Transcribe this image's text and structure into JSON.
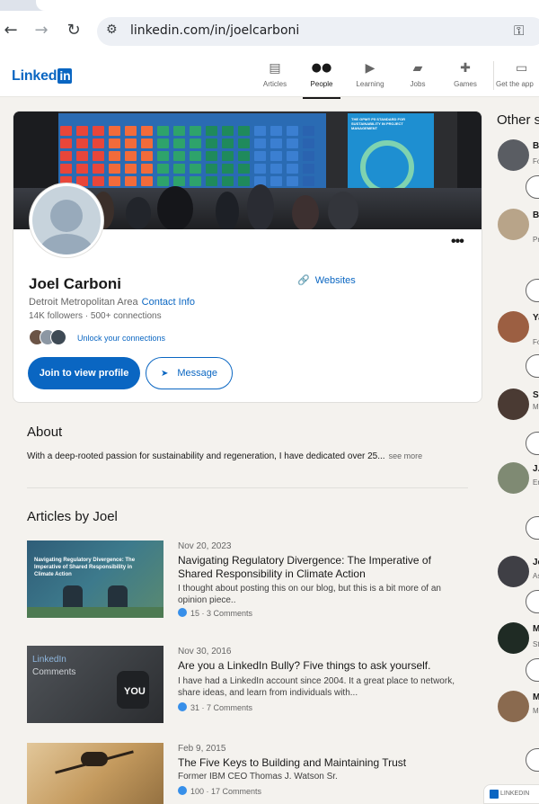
{
  "browser": {
    "url": "linkedin.com/in/joelcarboni",
    "back_icon": "←",
    "forward_icon": "→",
    "reload_icon": "↻",
    "tune_icon": "⚙",
    "key_icon": "⚿"
  },
  "header": {
    "logo_text": "Linked",
    "logo_badge": "in",
    "nav": [
      {
        "label": "Articles",
        "icon": "newspaper-icon",
        "glyph": "▤"
      },
      {
        "label": "People",
        "icon": "people-icon",
        "glyph": "👥",
        "active": true
      },
      {
        "label": "Learning",
        "icon": "play-icon",
        "glyph": "▶"
      },
      {
        "label": "Jobs",
        "icon": "briefcase-icon",
        "glyph": "💼"
      },
      {
        "label": "Games",
        "icon": "puzzle-icon",
        "glyph": "✚"
      },
      {
        "label": "Get the app",
        "icon": "laptop-icon",
        "glyph": "💻"
      }
    ]
  },
  "profile": {
    "name": "Joel Carboni",
    "location": "Detroit Metropolitan Area",
    "contact_info": "Contact Info",
    "followers": "14K followers",
    "connections": "500+ connections",
    "websites": "Websites",
    "unlock": "Unlock your connections",
    "join_button": "Join to view profile",
    "message_button": "Message",
    "more_icon": "•••"
  },
  "banner_labels": {
    "screen_text": "THE GPM® P5 STANDARD FOR SUSTAINABILITY IN PROJECT MANAGEMENT"
  },
  "about": {
    "title": "About",
    "text": "With a deep-rooted passion for sustainability and regeneration, I have dedicated over 25...",
    "see_more": "see more"
  },
  "articles": {
    "title": "Articles by Joel",
    "items": [
      {
        "date": "Nov 20, 2023",
        "title": "Navigating Regulatory Divergence: The Imperative of Shared Responsibility in Climate Action",
        "snippet": "I thought about posting this on our blog, but this is a bit more of an opinion piece..",
        "stats": "15 · 3 Comments",
        "thumb_text": "Navigating Regulatory Divergence: The Imperative of Shared Responsibility in Climate Action"
      },
      {
        "date": "Nov 30, 2016",
        "title": "Are you a LinkedIn Bully? Five things to ask yourself.",
        "snippet": "I have had a LinkedIn account since 2004. It a great place to network, share ideas, and learn from individuals with...",
        "stats": "31 · 7 Comments",
        "thumb_text_1": "LinkedIn",
        "thumb_text_2": "Comments",
        "thumb_text_3": "YOU"
      },
      {
        "date": "Feb 9, 2015",
        "title": "The Five Keys to Building and Maintaining Trust",
        "snippet": "Former IBM CEO Thomas J. Watson Sr.",
        "stats": "100 · 17 Comments"
      }
    ]
  },
  "rail": {
    "title": "Other s",
    "people": [
      {
        "name": "B",
        "sub": "Fo"
      },
      {
        "name": "B",
        "sub": "Pr"
      },
      {
        "name": "Ya",
        "sub": "Fo"
      },
      {
        "name": "Sh",
        "sub": "M"
      },
      {
        "name": "J.",
        "sub": "Er"
      },
      {
        "name": "Je",
        "sub": "As"
      },
      {
        "name": "M",
        "sub": "St"
      },
      {
        "name": "M",
        "sub": "M"
      }
    ]
  },
  "messaging_chip": "LINKEDIN",
  "colors": {
    "brand": "#0a66c2",
    "background": "#f4f2ee",
    "card": "#ffffff"
  }
}
